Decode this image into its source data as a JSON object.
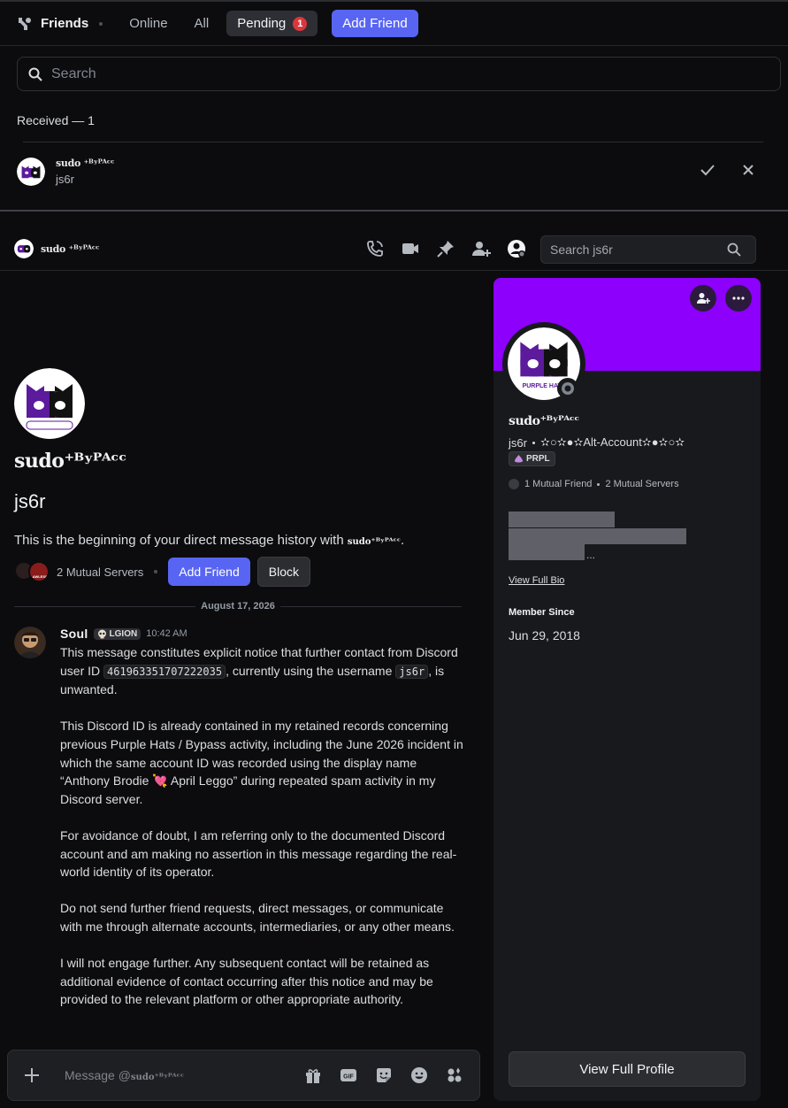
{
  "friends_header": {
    "title": "Friends",
    "tabs": {
      "online": "Online",
      "all": "All",
      "pending": "Pending"
    },
    "pending_badge": "1",
    "add_friend": "Add Friend"
  },
  "friends_search": {
    "placeholder": "Search"
  },
  "pending": {
    "section_title": "Received — 1",
    "request": {
      "display_name": "sudo ⁺ᴮʸᴾᴬᶜᶜ",
      "username": "js6r"
    }
  },
  "dm_header": {
    "display_name": "sudo ⁺ᴮʸᴾᴬᶜᶜ",
    "icons": [
      "voice-call-icon",
      "video-call-icon",
      "pin-icon",
      "add-friend-icon",
      "user-profile-icon"
    ],
    "search_placeholder": "Search js6r"
  },
  "dm_intro": {
    "display_name": "sudo⁺ᴮʸᴾᴬᶜᶜ",
    "username": "js6r",
    "begin_prefix": "This is the beginning of your direct message history with ",
    "begin_name": "sudo⁺ᴮʸᴾᴬᶜᶜ",
    "begin_suffix": ".",
    "mutual_servers": "2 Mutual Servers",
    "mutual_server_icon_label": "LAWLESS",
    "add_friend": "Add Friend",
    "block": "Block"
  },
  "date_separator": "August 17, 2026",
  "message": {
    "author": "Soul",
    "tag": "LGION",
    "time": "10:42 AM",
    "p1_before_id": "This message constitutes explicit notice that further contact from Discord user ID ",
    "p1_id": "461963351707222035",
    "p1_middle": ", currently using the username ",
    "p1_username": "js6r",
    "p1_after": ", is unwanted.",
    "p2_before_emoji": "This Discord ID is already contained in my retained records concerning previous Purple Hats / Bypass activity, including the June 2026 incident in which the same account ID was recorded using the display name “Anthony Brodie ",
    "p2_emoji": "💘",
    "p2_after_emoji": " April Leggo” during repeated spam activity in my Discord server.",
    "p3": "For avoidance of doubt, I am referring only to the documented Discord account and am making no assertion in this message regarding the real-world identity of its operator.",
    "p4": "Do not send further friend requests, direct messages, or communicate with me through alternate accounts, intermediaries, or any other means.",
    "p5": "I will not engage further. Any subsequent contact will be retained as additional evidence of contact occurring after this notice and may be provided to the relevant platform or other appropriate authority."
  },
  "composer": {
    "placeholder_prefix": "Message @",
    "placeholder_name": "sudo⁺ᴮʸᴾᴬᶜᶜ",
    "icons": [
      "gift-icon",
      "gif-icon",
      "sticker-icon",
      "emoji-icon",
      "apps-icon"
    ]
  },
  "profile": {
    "banner_color": "#8c00fc",
    "avatar_label": "PURPLE HATS",
    "display_name": "sudo⁺ᴮʸᴾᴬᶜᶜ",
    "username": "js6r",
    "custom_status": "✫○✫●✫Alt-Account✫●✫○✫",
    "tag": "PRPL",
    "mutual_friends": "1 Mutual Friend",
    "mutual_servers": "2 Mutual Servers",
    "bio_ellipsis": "...",
    "view_full_bio": "View Full Bio",
    "member_since_title": "Member Since",
    "member_since": "Jun 29, 2018",
    "view_full_profile": "View Full Profile"
  },
  "colors": {
    "accent": "#5865f2",
    "danger": "#da373c",
    "background": "#0c0c0f",
    "panel": "#18191c"
  }
}
